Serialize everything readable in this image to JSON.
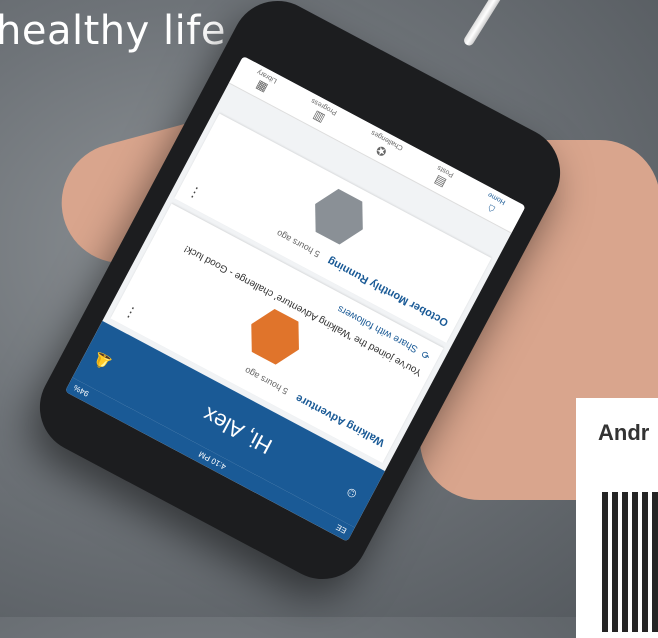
{
  "headline": "healthy life.",
  "app": {
    "status": {
      "time": "4:10 PM",
      "carrier": "EE",
      "battery": "94%"
    },
    "header": {
      "greeting": "Hi, Alex"
    },
    "feed": [
      {
        "title": "Walking Adventure",
        "ago": "5 hours ago",
        "body": "You've joined the 'Walking Adventure' challenge - Good luck!",
        "share": "Share with followers"
      },
      {
        "title": "October Monthly Running",
        "ago": "5 hours ago"
      }
    ],
    "nav": [
      "Home",
      "Posts",
      "Challenges",
      "Progress",
      "Library"
    ]
  },
  "qr_card": {
    "label": "Andr"
  },
  "colors": {
    "brand_blue": "#1a5a96",
    "badge_orange": "#e0742b"
  }
}
